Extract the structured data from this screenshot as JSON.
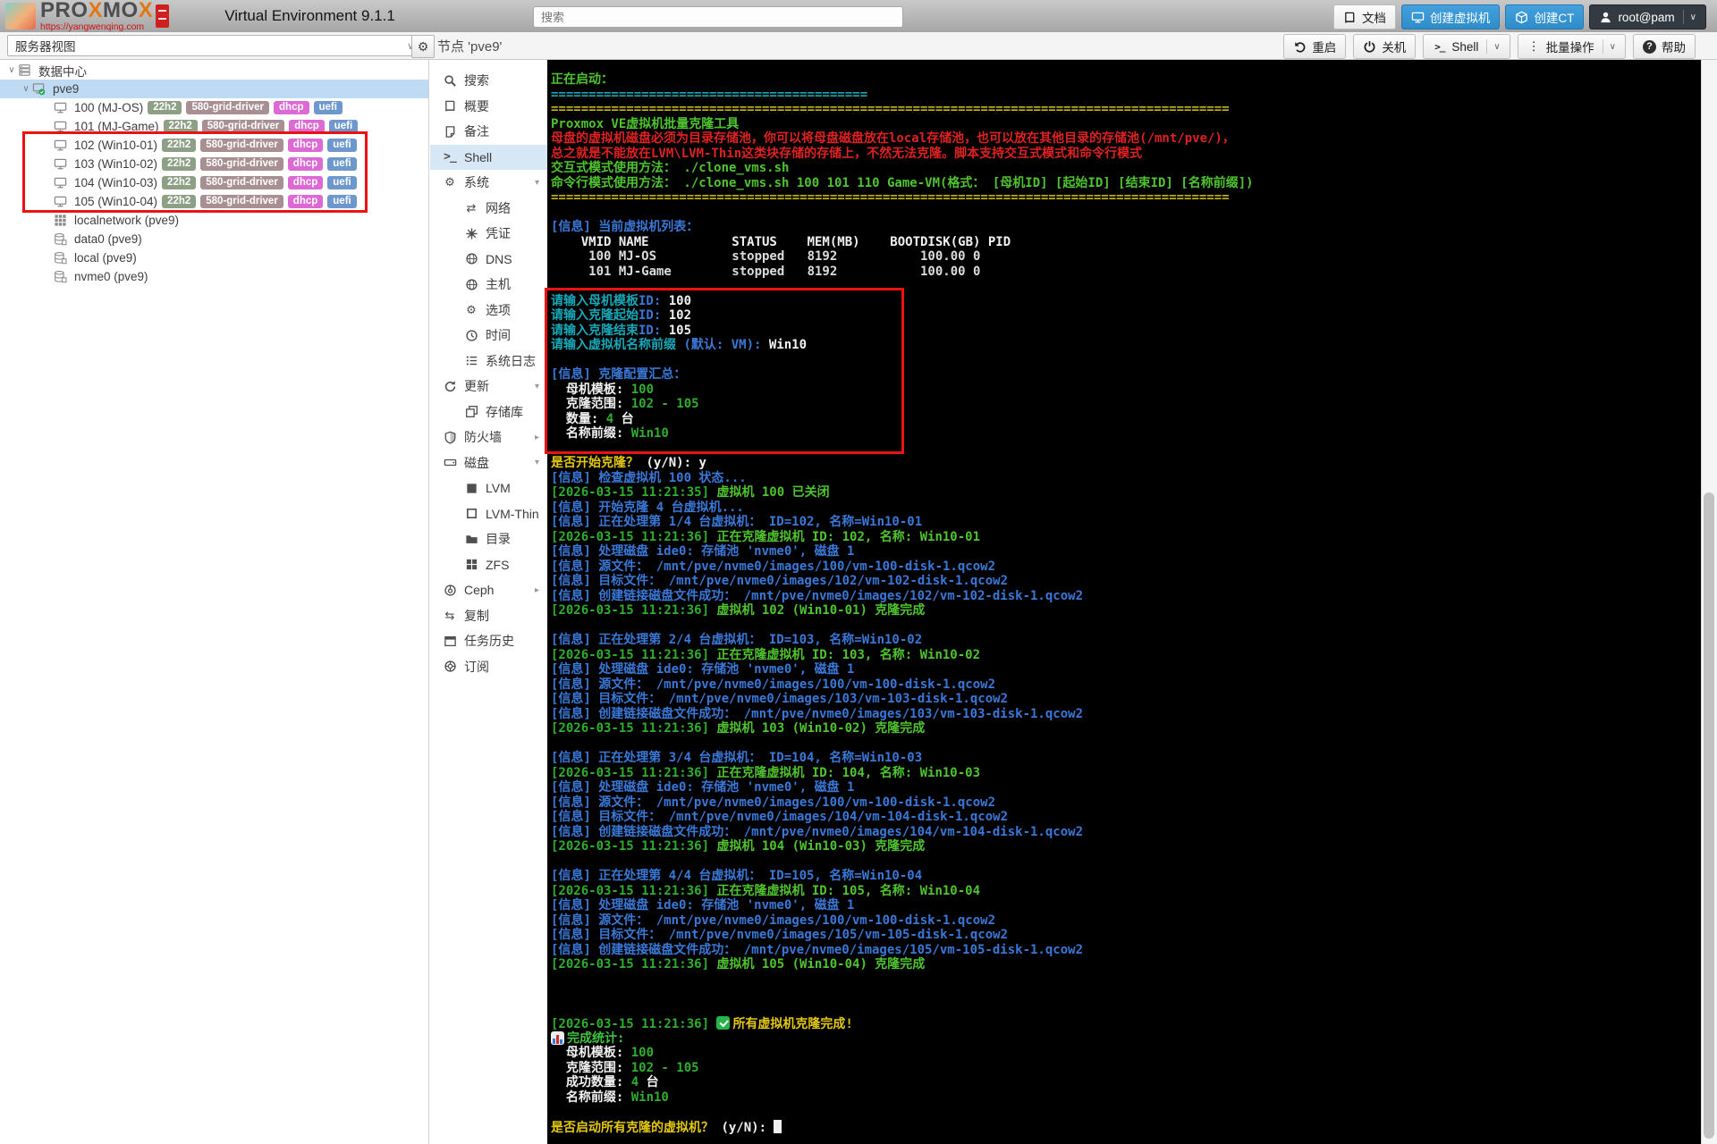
{
  "colors": {
    "accent_blue": "#2e8cc9",
    "terminal_green": "#2eae2e",
    "terminal_lime": "#4fc42f",
    "terminal_blue": "#3a78d8",
    "terminal_teal": "#16a8b8",
    "terminal_yellow": "#e3c710",
    "terminal_red": "#de2121",
    "annotation_red": "#ec1212",
    "selection_blue": "#bedbf3"
  },
  "header": {
    "logo": {
      "brand": "PROXMOX",
      "url": "https://yangwenqing.com"
    },
    "version_label": "Virtual Environment 9.1.1",
    "search_placeholder": "搜索",
    "actions": [
      {
        "label": "文档",
        "icon": "book",
        "style": "light"
      },
      {
        "label": "创建虚拟机",
        "icon": "monitor",
        "style": "primary"
      },
      {
        "label": "创建CT",
        "icon": "cube",
        "style": "primary"
      },
      {
        "label": "root@pam",
        "icon": "person",
        "style": "dark",
        "chevron": true
      }
    ]
  },
  "view_bar": {
    "selector_label": "服务器视图"
  },
  "node_toolbar": {
    "title": "节点 'pve9'",
    "buttons": [
      {
        "icon": "undo",
        "label": "重启"
      },
      {
        "icon": "power",
        "label": "关机"
      },
      {
        "icon": "terminal",
        "label": "Shell",
        "split": true
      },
      {
        "icon": "ellipsis",
        "label": "批量操作",
        "split": true
      },
      {
        "icon": "help",
        "label": "帮助"
      }
    ]
  },
  "tag_colors": {
    "22h2": "#8d9f84",
    "580-grid-driver": "#a88f93",
    "dhcp": "#dd6ad4",
    "uefi": "#6d98ce"
  },
  "tree": {
    "items": [
      {
        "icon": "servers",
        "label": "数据中心",
        "depth": 0,
        "expander": true
      },
      {
        "icon": "server-ok",
        "label": "pve9",
        "depth": 1,
        "expander": true,
        "selected": true
      },
      {
        "icon": "monitor",
        "label": "100 (MJ-OS)",
        "depth": 2,
        "tags": [
          "22h2",
          "580-grid-driver",
          "dhcp",
          "uefi"
        ]
      },
      {
        "icon": "monitor",
        "label": "101 (MJ-Game)",
        "depth": 2,
        "tags": [
          "22h2",
          "580-grid-driver",
          "dhcp",
          "uefi"
        ]
      },
      {
        "icon": "monitor",
        "label": "102 (Win10-01)",
        "depth": 2,
        "tags": [
          "22h2",
          "580-grid-driver",
          "dhcp",
          "uefi"
        ]
      },
      {
        "icon": "monitor",
        "label": "103 (Win10-02)",
        "depth": 2,
        "tags": [
          "22h2",
          "580-grid-driver",
          "dhcp",
          "uefi"
        ]
      },
      {
        "icon": "monitor",
        "label": "104 (Win10-03)",
        "depth": 2,
        "tags": [
          "22h2",
          "580-grid-driver",
          "dhcp",
          "uefi"
        ]
      },
      {
        "icon": "monitor",
        "label": "105 (Win10-04)",
        "depth": 2,
        "tags": [
          "22h2",
          "580-grid-driver",
          "dhcp",
          "uefi"
        ]
      },
      {
        "icon": "grid9",
        "label": "localnetwork (pve9)",
        "depth": 2
      },
      {
        "icon": "storage",
        "label": "data0 (pve9)",
        "depth": 2
      },
      {
        "icon": "storage",
        "label": "local (pve9)",
        "depth": 2
      },
      {
        "icon": "storage",
        "label": "nvme0 (pve9)",
        "depth": 2
      }
    ]
  },
  "menu": {
    "items": [
      {
        "icon": "search",
        "label": "搜索"
      },
      {
        "icon": "book",
        "label": "概要"
      },
      {
        "icon": "note",
        "label": "备注"
      },
      {
        "icon": "terminal",
        "label": "Shell",
        "selected": true
      },
      {
        "icon": "gears",
        "label": "系统",
        "chevron": "down"
      },
      {
        "icon": "network",
        "label": "网络",
        "depth": 1
      },
      {
        "icon": "cert",
        "label": "凭证",
        "depth": 1
      },
      {
        "icon": "globe",
        "label": "DNS",
        "depth": 1
      },
      {
        "icon": "globe",
        "label": "主机",
        "depth": 1
      },
      {
        "icon": "gear",
        "label": "选项",
        "depth": 1
      },
      {
        "icon": "clock",
        "label": "时间",
        "depth": 1
      },
      {
        "icon": "syslog",
        "label": "系统日志",
        "depth": 1
      },
      {
        "icon": "refresh",
        "label": "更新",
        "chevron": "down"
      },
      {
        "icon": "copy",
        "label": "存储库",
        "depth": 1
      },
      {
        "icon": "shield",
        "label": "防火墙",
        "chevron": "right"
      },
      {
        "icon": "drive",
        "label": "磁盘",
        "chevron": "down"
      },
      {
        "icon": "lvm",
        "label": "LVM",
        "depth": 1
      },
      {
        "icon": "lvm-thin",
        "label": "LVM-Thin",
        "depth": 1
      },
      {
        "icon": "folder",
        "label": "目录",
        "depth": 1
      },
      {
        "icon": "zfs",
        "label": "ZFS",
        "depth": 1
      },
      {
        "icon": "ceph",
        "label": "Ceph",
        "chevron": "right"
      },
      {
        "icon": "replicate",
        "label": "复制"
      },
      {
        "icon": "tasklist",
        "label": "任务历史"
      },
      {
        "icon": "support",
        "label": "订阅"
      }
    ]
  },
  "terminal": {
    "lines": [
      [
        {
          "t": "正在启动：",
          "c": "msg"
        }
      ],
      [
        {
          "t": "==========================================",
          "c": "teal"
        }
      ],
      [
        {
          "t": "==========================================================================================",
          "c": "sep"
        }
      ],
      [
        {
          "t": "Proxmox VE虚拟机批量克隆工具",
          "c": "msg"
        }
      ],
      [
        {
          "t": "母盘的虚拟机磁盘必须为目录存储池，你可以将母盘磁盘放在local存储池，也可以放在其他目录的存储池(/mnt/pve/)，",
          "c": "err"
        }
      ],
      [
        {
          "t": "总之就是不能放在LVM\\LVM-Thin这类块存储的存储上，不然无法克隆。脚本支持交互式模式和命令行模式",
          "c": "err"
        }
      ],
      [
        {
          "t": "交互式模式使用方法： ./clone_vms.sh",
          "c": "msg"
        }
      ],
      [
        {
          "t": "命令行模式使用方法： ./clone_vms.sh 100 101 110 Game-VM(格式： [母机ID] [起始ID] [结束ID] [名称前缀])",
          "c": "msg"
        }
      ],
      [
        {
          "t": "==========================================================================================",
          "c": "sep"
        }
      ],
      [],
      [
        {
          "t": "[信息] 当前虚拟机列表：",
          "c": "info"
        }
      ],
      [
        {
          "t": "    VMID NAME           STATUS    MEM(MB)    BOOTDISK(GB) PID",
          "c": "wb"
        }
      ],
      [
        {
          "t": "     100 MJ-OS          stopped   8192           100.00 0",
          "c": "w"
        }
      ],
      [
        {
          "t": "     101 MJ-Game        stopped   8192           100.00 0",
          "c": "w"
        }
      ],
      [],
      [
        {
          "t": "请输入母机模板",
          "c": "teal"
        },
        {
          "t": "ID: ",
          "c": "info"
        },
        {
          "t": "100",
          "c": "wb"
        }
      ],
      [
        {
          "t": "请输入克隆起始",
          "c": "teal"
        },
        {
          "t": "ID: ",
          "c": "info"
        },
        {
          "t": "102",
          "c": "wb"
        }
      ],
      [
        {
          "t": "请输入克隆结束",
          "c": "teal"
        },
        {
          "t": "ID: ",
          "c": "info"
        },
        {
          "t": "105",
          "c": "wb"
        }
      ],
      [
        {
          "t": "请输入虚拟机名称前缀 ",
          "c": "teal"
        },
        {
          "t": "(默认: VM): ",
          "c": "info"
        },
        {
          "t": "Win10",
          "c": "wb"
        }
      ],
      [],
      [
        {
          "t": "[信息] 克隆配置汇总：",
          "c": "info"
        }
      ],
      [
        {
          "t": "  母机模板: ",
          "c": "wb"
        },
        {
          "t": "100",
          "c": "ts"
        }
      ],
      [
        {
          "t": "  克隆范围: ",
          "c": "wb"
        },
        {
          "t": "102 - 105",
          "c": "ts"
        }
      ],
      [
        {
          "t": "  数量: ",
          "c": "wb"
        },
        {
          "t": "4",
          "c": "ts"
        },
        {
          "t": " 台",
          "c": "wb"
        }
      ],
      [
        {
          "t": "  名称前缀: ",
          "c": "wb"
        },
        {
          "t": "Win10",
          "c": "ts"
        }
      ],
      [],
      [
        {
          "t": "是否开始克隆？ ",
          "c": "prompt"
        },
        {
          "t": "(y/N): y",
          "c": "wb"
        }
      ],
      [
        {
          "t": "[信息] 检查虚拟机 100 状态...",
          "c": "info"
        }
      ],
      [
        {
          "t": "[2026-03-15 11:21:35]",
          "c": "ts"
        },
        {
          "t": " 虚拟机 100 已关闭",
          "c": "msg"
        }
      ],
      [
        {
          "t": "[信息] 开始克隆 4 台虚拟机...",
          "c": "info"
        }
      ],
      [
        {
          "t": "[信息] 正在处理第 1/4 台虚拟机： ID=102, 名称=Win10-01",
          "c": "info"
        }
      ],
      [
        {
          "t": "[2026-03-15 11:21:36]",
          "c": "ts"
        },
        {
          "t": " 正在克隆虚拟机 ID: 102, 名称: Win10-01",
          "c": "msg"
        }
      ],
      [
        {
          "t": "[信息] 处理磁盘 ide0: 存储池 'nvme0', 磁盘 1",
          "c": "info"
        }
      ],
      [
        {
          "t": "[信息] 源文件： /mnt/pve/nvme0/images/100/vm-100-disk-1.qcow2",
          "c": "info"
        }
      ],
      [
        {
          "t": "[信息] 目标文件： /mnt/pve/nvme0/images/102/vm-102-disk-1.qcow2",
          "c": "info"
        }
      ],
      [
        {
          "t": "[信息] 创建链接磁盘文件成功： /mnt/pve/nvme0/images/102/vm-102-disk-1.qcow2",
          "c": "info"
        }
      ],
      [
        {
          "t": "[2026-03-15 11:21:36]",
          "c": "ts"
        },
        {
          "t": " 虚拟机 102 (Win10-01) 克隆完成",
          "c": "msg"
        }
      ],
      [],
      [
        {
          "t": "[信息] 正在处理第 2/4 台虚拟机： ID=103, 名称=Win10-02",
          "c": "info"
        }
      ],
      [
        {
          "t": "[2026-03-15 11:21:36]",
          "c": "ts"
        },
        {
          "t": " 正在克隆虚拟机 ID: 103, 名称: Win10-02",
          "c": "msg"
        }
      ],
      [
        {
          "t": "[信息] 处理磁盘 ide0: 存储池 'nvme0', 磁盘 1",
          "c": "info"
        }
      ],
      [
        {
          "t": "[信息] 源文件： /mnt/pve/nvme0/images/100/vm-100-disk-1.qcow2",
          "c": "info"
        }
      ],
      [
        {
          "t": "[信息] 目标文件： /mnt/pve/nvme0/images/103/vm-103-disk-1.qcow2",
          "c": "info"
        }
      ],
      [
        {
          "t": "[信息] 创建链接磁盘文件成功： /mnt/pve/nvme0/images/103/vm-103-disk-1.qcow2",
          "c": "info"
        }
      ],
      [
        {
          "t": "[2026-03-15 11:21:36]",
          "c": "ts"
        },
        {
          "t": " 虚拟机 103 (Win10-02) 克隆完成",
          "c": "msg"
        }
      ],
      [],
      [
        {
          "t": "[信息] 正在处理第 3/4 台虚拟机： ID=104, 名称=Win10-03",
          "c": "info"
        }
      ],
      [
        {
          "t": "[2026-03-15 11:21:36]",
          "c": "ts"
        },
        {
          "t": " 正在克隆虚拟机 ID: 104, 名称: Win10-03",
          "c": "msg"
        }
      ],
      [
        {
          "t": "[信息] 处理磁盘 ide0: 存储池 'nvme0', 磁盘 1",
          "c": "info"
        }
      ],
      [
        {
          "t": "[信息] 源文件： /mnt/pve/nvme0/images/100/vm-100-disk-1.qcow2",
          "c": "info"
        }
      ],
      [
        {
          "t": "[信息] 目标文件： /mnt/pve/nvme0/images/104/vm-104-disk-1.qcow2",
          "c": "info"
        }
      ],
      [
        {
          "t": "[信息] 创建链接磁盘文件成功： /mnt/pve/nvme0/images/104/vm-104-disk-1.qcow2",
          "c": "info"
        }
      ],
      [
        {
          "t": "[2026-03-15 11:21:36]",
          "c": "ts"
        },
        {
          "t": " 虚拟机 104 (Win10-03) 克隆完成",
          "c": "msg"
        }
      ],
      [],
      [
        {
          "t": "[信息] 正在处理第 4/4 台虚拟机： ID=105, 名称=Win10-04",
          "c": "info"
        }
      ],
      [
        {
          "t": "[2026-03-15 11:21:36]",
          "c": "ts"
        },
        {
          "t": " 正在克隆虚拟机 ID: 105, 名称: Win10-04",
          "c": "msg"
        }
      ],
      [
        {
          "t": "[信息] 处理磁盘 ide0: 存储池 'nvme0', 磁盘 1",
          "c": "info"
        }
      ],
      [
        {
          "t": "[信息] 源文件： /mnt/pve/nvme0/images/100/vm-100-disk-1.qcow2",
          "c": "info"
        }
      ],
      [
        {
          "t": "[信息] 目标文件： /mnt/pve/nvme0/images/105/vm-105-disk-1.qcow2",
          "c": "info"
        }
      ],
      [
        {
          "t": "[信息] 创建链接磁盘文件成功： /mnt/pve/nvme0/images/105/vm-105-disk-1.qcow2",
          "c": "info"
        }
      ],
      [
        {
          "t": "[2026-03-15 11:21:36]",
          "c": "ts"
        },
        {
          "t": " 虚拟机 105 (Win10-04) 克隆完成",
          "c": "msg"
        }
      ],
      [],
      [],
      [],
      [
        {
          "t": "[2026-03-15 11:21:36] ",
          "c": "ts"
        },
        {
          "i": "check"
        },
        {
          "t": "所有虚拟机克隆完成!",
          "c": "prompt"
        }
      ],
      [
        {
          "i": "chart"
        },
        {
          "t": "完成统计:",
          "c": "gb"
        }
      ],
      [
        {
          "t": "  母机模板: ",
          "c": "wb"
        },
        {
          "t": "100",
          "c": "ts"
        }
      ],
      [
        {
          "t": "  克隆范围: ",
          "c": "wb"
        },
        {
          "t": "102 - 105",
          "c": "ts"
        }
      ],
      [
        {
          "t": "  成功数量: ",
          "c": "wb"
        },
        {
          "t": "4",
          "c": "ts"
        },
        {
          "t": " 台",
          "c": "wb"
        }
      ],
      [
        {
          "t": "  名称前缀: ",
          "c": "wb"
        },
        {
          "t": "Win10",
          "c": "ts"
        }
      ],
      [],
      [
        {
          "t": "是否启动所有克隆的虚拟机？ ",
          "c": "prompt"
        },
        {
          "t": "(y/N): ",
          "c": "wb"
        },
        {
          "i": "cursor"
        }
      ]
    ]
  }
}
